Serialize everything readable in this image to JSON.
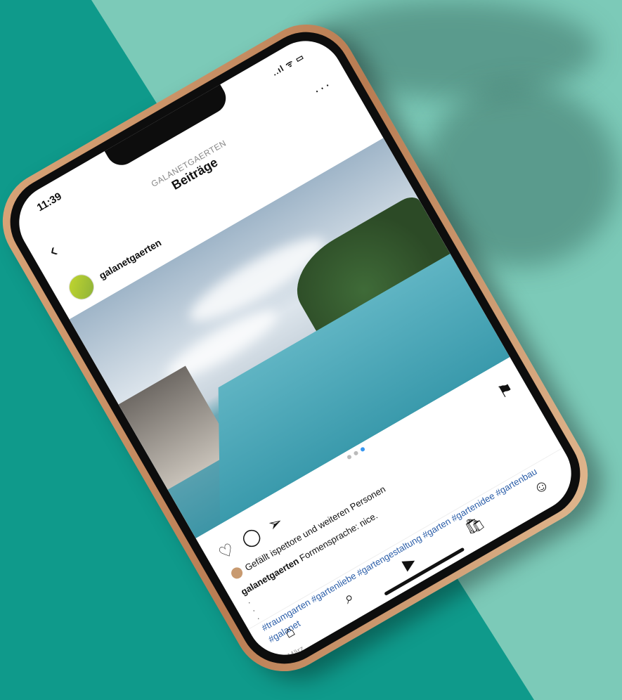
{
  "status": {
    "time": "11:39",
    "signal": "..ıl ᯤ ▭"
  },
  "nav": {
    "subtitle": "GALANETGAERTEN",
    "title": "Beiträge",
    "back_icon": "chevron-left-icon",
    "more": "···"
  },
  "post": {
    "account": "galanetgaerten",
    "likes_text": "Gefällt ispettore und weiteren Personen",
    "caption_user": "galanetgaerten",
    "caption_text": "Formensprache: nice.",
    "dashes": "·\n·\n·",
    "hashtags": "#traumgarten #gartenliebe #gartengestaltung #garten #gartenidee #gartenbau #galanet",
    "date": "1. März"
  },
  "icons": {
    "like": "heart-icon",
    "comment": "comment-icon",
    "share": "send-icon",
    "save": "bookmark-icon",
    "tab_home": "home-icon",
    "tab_search": "search-icon",
    "tab_reels": "reels-icon",
    "tab_shop": "shop-icon",
    "tab_profile": "profile-icon"
  },
  "colors": {
    "background_teal": "#0f9a8b",
    "background_light": "#7ccab8",
    "phone_frame": "#c58a5c",
    "hashtag_link": "#2a5da8"
  }
}
